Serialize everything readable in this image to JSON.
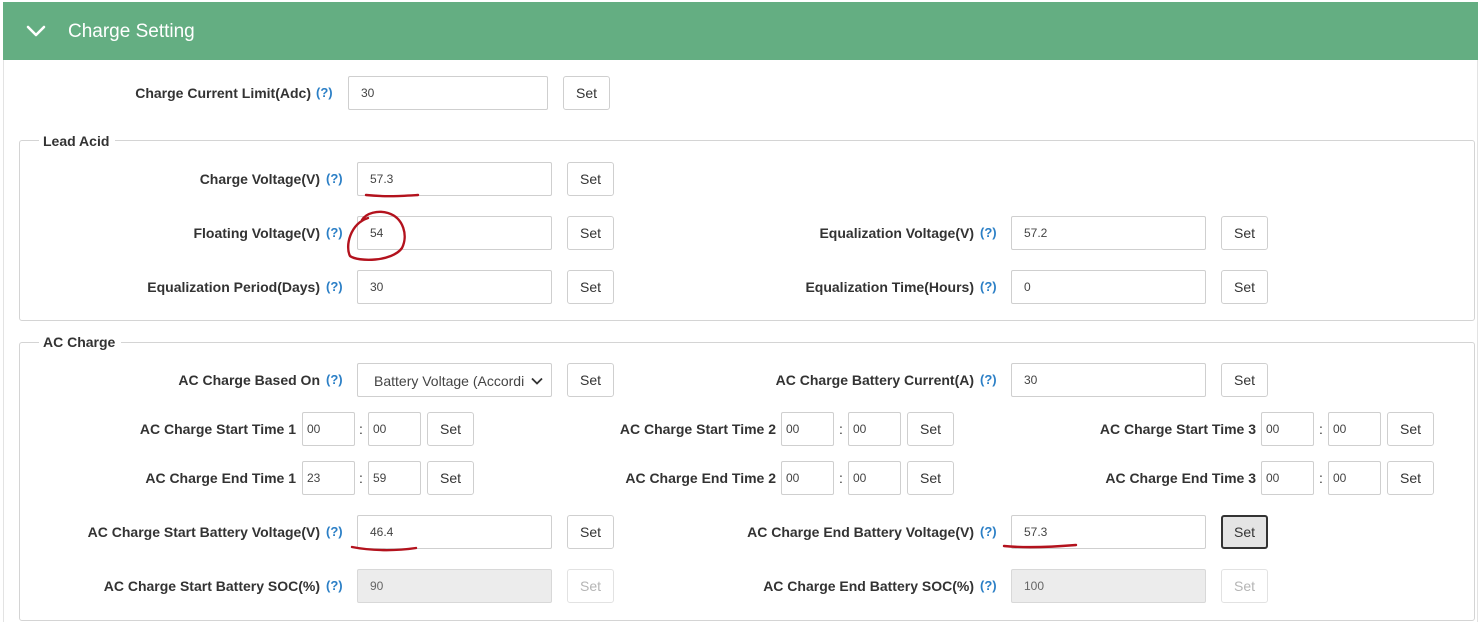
{
  "section": {
    "title": "Charge Setting"
  },
  "help": "(?)",
  "set_label": "Set",
  "charge_current_limit": {
    "label": "Charge Current Limit(Adc)",
    "value": "30"
  },
  "lead_acid": {
    "legend": "Lead Acid",
    "charge_voltage": {
      "label": "Charge Voltage(V)",
      "value": "57.3"
    },
    "floating_voltage": {
      "label": "Floating Voltage(V)",
      "value": "54"
    },
    "equalization_voltage": {
      "label": "Equalization Voltage(V)",
      "value": "57.2"
    },
    "equalization_period": {
      "label": "Equalization Period(Days)",
      "value": "30"
    },
    "equalization_time": {
      "label": "Equalization Time(Hours)",
      "value": "0"
    }
  },
  "ac_charge": {
    "legend": "AC Charge",
    "based_on": {
      "label": "AC Charge Based On",
      "value": "Battery Voltage (According to..."
    },
    "battery_current": {
      "label": "AC Charge Battery Current(A)",
      "value": "30"
    },
    "start_time_1": {
      "label": "AC Charge Start Time 1",
      "hour": "00",
      "minute": "00"
    },
    "start_time_2": {
      "label": "AC Charge Start Time 2",
      "hour": "00",
      "minute": "00"
    },
    "start_time_3": {
      "label": "AC Charge Start Time 3",
      "hour": "00",
      "minute": "00"
    },
    "end_time_1": {
      "label": "AC Charge End Time 1",
      "hour": "23",
      "minute": "59"
    },
    "end_time_2": {
      "label": "AC Charge End Time 2",
      "hour": "00",
      "minute": "00"
    },
    "end_time_3": {
      "label": "AC Charge End Time 3",
      "hour": "00",
      "minute": "00"
    },
    "start_battery_voltage": {
      "label": "AC Charge Start Battery Voltage(V)",
      "value": "46.4"
    },
    "end_battery_voltage": {
      "label": "AC Charge End Battery Voltage(V)",
      "value": "57.3"
    },
    "start_battery_soc": {
      "label": "AC Charge Start Battery SOC(%)",
      "value": "90"
    },
    "end_battery_soc": {
      "label": "AC Charge End Battery SOC(%)",
      "value": "100"
    }
  },
  "colors": {
    "header": "#64ae82",
    "help": "#2b7fc6",
    "annotation": "#b3121d"
  }
}
